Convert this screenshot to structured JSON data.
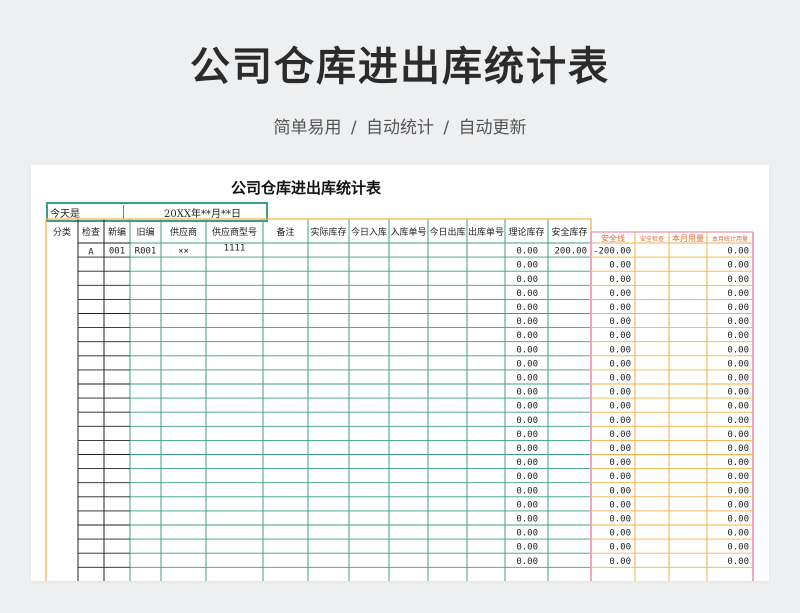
{
  "hero": {
    "title": "公司仓库进出库统计表",
    "subtitle": "简单易用  /  自动统计  /  自动更新"
  },
  "sheet": {
    "title": "公司仓库进出库统计表",
    "date_label": "今天是",
    "date_value": "20XX年**月**日",
    "headers": [
      "分类",
      "检查",
      "新编",
      "旧编",
      "供应商",
      "供应商型号",
      "备注",
      "实际库存",
      "今日入库",
      "入库单号",
      "今日出库",
      "出库单号",
      "理论库存",
      "安全库存"
    ],
    "right_headers": [
      "安全线",
      "安全检查",
      "本月用量",
      "本月统计用量"
    ],
    "first_row": {
      "category": "",
      "check": "A",
      "new_code": "001",
      "old_code": "R001",
      "supplier": "××",
      "model": "1111",
      "theory_stock": "0.00",
      "safety_stock": "200.00",
      "safety_line": "-200.00",
      "monthly_stat": "0.00"
    },
    "zero_value": "0.00",
    "row_count": 23,
    "colors": {
      "green": "#3f9e86",
      "orange": "#f2b24a",
      "pink": "#f1a3c0",
      "red": "#e0311f"
    }
  }
}
